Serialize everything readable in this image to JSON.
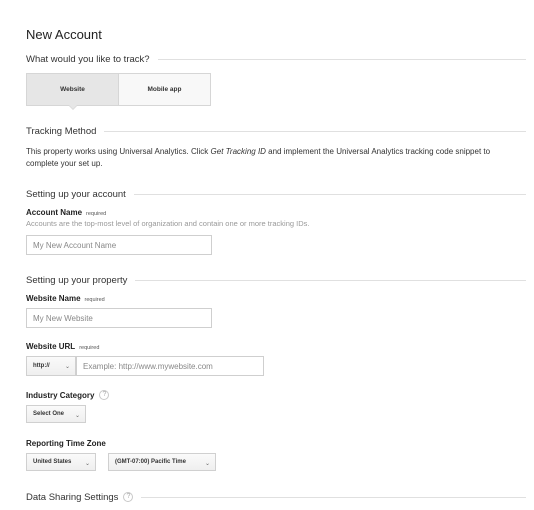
{
  "page": {
    "title": "New Account"
  },
  "track": {
    "question": "What would you like to track?",
    "options": [
      {
        "label": "Website",
        "selected": true
      },
      {
        "label": "Mobile app",
        "selected": false
      }
    ]
  },
  "tracking_method": {
    "heading": "Tracking Method",
    "text_before": "This property works using Universal Analytics. Click ",
    "text_emphasis": "Get Tracking ID",
    "text_after": " and implement the Universal Analytics tracking code snippet to complete your set up."
  },
  "account": {
    "heading": "Setting up your account",
    "name_label": "Account Name",
    "required": "required",
    "hint": "Accounts are the top-most level of organization and contain one or more tracking IDs.",
    "name_placeholder": "My New Account Name"
  },
  "property": {
    "heading": "Setting up your property",
    "website_name_label": "Website Name",
    "website_name_placeholder": "My New Website",
    "website_url_label": "Website URL",
    "protocol": "http://",
    "url_placeholder": "Example: http://www.mywebsite.com",
    "industry_label": "Industry Category",
    "industry_value": "Select One",
    "timezone_label": "Reporting Time Zone",
    "country_value": "United States",
    "timezone_value": "(GMT-07:00) Pacific Time"
  },
  "data_sharing": {
    "heading": "Data Sharing Settings"
  },
  "icons": {
    "help": "help-icon",
    "dropdown": "chevron-down-icon"
  }
}
